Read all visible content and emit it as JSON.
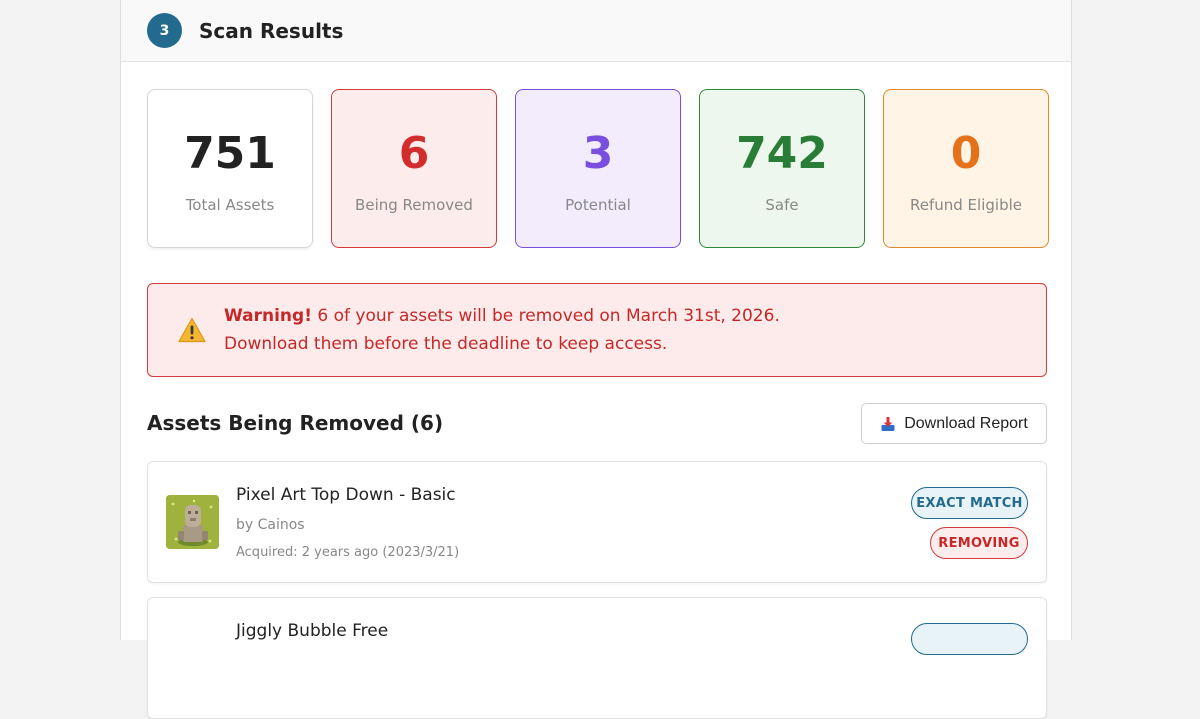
{
  "header": {
    "step": "3",
    "title": "Scan Results"
  },
  "stats": [
    {
      "value": "751",
      "label": "Total Assets"
    },
    {
      "value": "6",
      "label": "Being Removed"
    },
    {
      "value": "3",
      "label": "Potential"
    },
    {
      "value": "742",
      "label": "Safe"
    },
    {
      "value": "0",
      "label": "Refund Eligible"
    }
  ],
  "warning": {
    "strong": "Warning!",
    "line1": " 6 of your assets will be removed on March 31st, 2026.",
    "line2": "Download them before the deadline to keep access."
  },
  "section": {
    "title": "Assets Being Removed (6)",
    "download_label": "Download Report"
  },
  "assets": [
    {
      "name": "Pixel Art Top Down - Basic",
      "author": "by Cainos",
      "acquired": "Acquired: 2 years ago (2023/3/21)",
      "match": "EXACT MATCH",
      "status": "REMOVING"
    },
    {
      "name": "Jiggly Bubble Free",
      "author": "",
      "acquired": "",
      "match": "",
      "status": ""
    }
  ],
  "colors": {
    "accent": "#236b8e",
    "danger": "#d22d2d",
    "potential": "#7a4fe0",
    "safe": "#2a7d36",
    "refund": "#e4721a"
  }
}
